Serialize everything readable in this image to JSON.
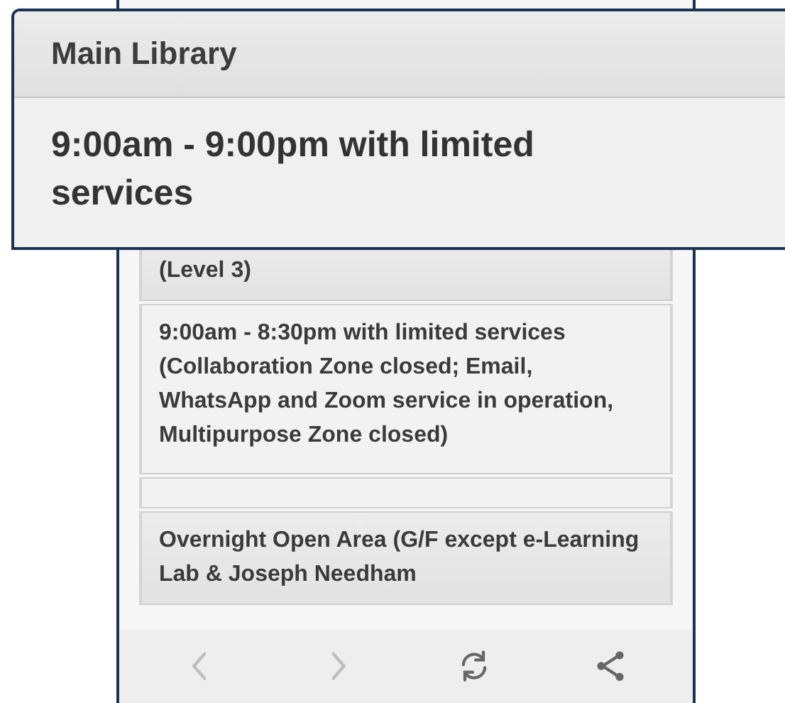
{
  "popup": {
    "title": "Main Library",
    "hours": "9:00am - 9:00pm with limited services"
  },
  "sections": [
    {
      "kind": "header",
      "text": "(Level 3)"
    },
    {
      "kind": "body",
      "text": "9:00am - 8:30pm with limited services (Collaboration Zone closed; Email, WhatsApp and Zoom service in operation, Multipurpose Zone closed)"
    },
    {
      "kind": "spacer"
    },
    {
      "kind": "header",
      "text": "Overnight Open Area (G/F except e-Learning Lab & Joseph Needham"
    }
  ],
  "toolbar": [
    {
      "kind": "back",
      "disabled": true
    },
    {
      "kind": "forward",
      "disabled": true
    },
    {
      "kind": "refresh",
      "disabled": false
    },
    {
      "kind": "share",
      "disabled": false
    }
  ]
}
